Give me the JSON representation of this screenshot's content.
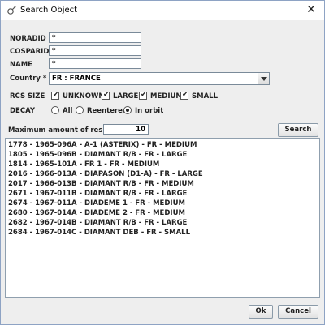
{
  "window": {
    "title": "Search Object"
  },
  "form": {
    "noradid_label": "NORADID",
    "noradid_value": "*",
    "cospard_label": "COSPARID",
    "cospard_value": "*",
    "name_label": "NAME",
    "name_value": "*",
    "country_label": "Country *",
    "country_value": "FR : FRANCE",
    "rcs_label": "RCS SIZE",
    "rcs_options": [
      {
        "label": "UNKNOWN",
        "checked": true
      },
      {
        "label": "LARGE",
        "checked": true
      },
      {
        "label": "MEDIUM",
        "checked": true
      },
      {
        "label": "SMALL",
        "checked": true
      }
    ],
    "decay_label": "DECAY",
    "decay_options": [
      {
        "label": "All",
        "selected": false
      },
      {
        "label": "Reentered",
        "selected": false
      },
      {
        "label": "In orbit",
        "selected": true
      }
    ],
    "max_results_label": "Maximum amount of results:",
    "max_results_value": "10",
    "search_button": "Search"
  },
  "results": [
    "1778 - 1965-096A - A-1 (ASTERIX) - FR - MEDIUM",
    "1805 - 1965-096B - DIAMANT R/B - FR - LARGE",
    "1814 - 1965-101A - FR 1 - FR - MEDIUM",
    "2016 - 1966-013A - DIAPASON (D1-A) - FR - LARGE",
    "2017 - 1966-013B - DIAMANT R/B - FR - MEDIUM",
    "2671 - 1967-011B - DIAMANT R/B - FR - LARGE",
    "2674 - 1967-011A - DIADEME 1 - FR - MEDIUM",
    "2680 - 1967-014A - DIADEME 2 - FR - MEDIUM",
    "2682 - 1967-014B - DIAMANT R/B - FR - LARGE",
    "2684 - 1967-014C - DIAMANT DEB - FR - SMALL"
  ],
  "footer": {
    "ok_button": "Ok",
    "cancel_button": "Cancel"
  },
  "icons": {
    "app": "satellite-dish-icon",
    "close": "close-icon"
  }
}
